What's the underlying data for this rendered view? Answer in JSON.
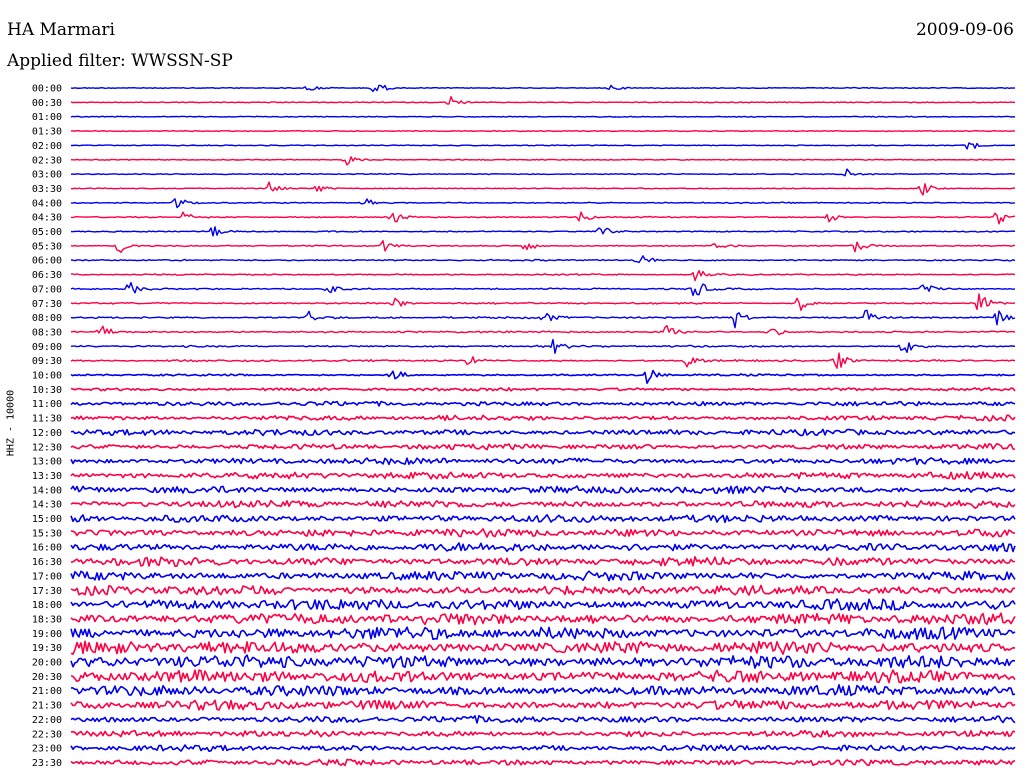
{
  "header": {
    "station": "HA Marmari",
    "date": "2009-09-06",
    "filter": "Applied filter: WWSSN-SP"
  },
  "chart_data": {
    "type": "line",
    "title": "HA Marmari",
    "subtitle": "Applied filter: WWSSN-SP",
    "ylabel": "HHZ - 10000",
    "xlabel": "",
    "colors": [
      "#0000ee",
      "#ff0044"
    ],
    "row_labels": [
      "00:00",
      "00:30",
      "01:00",
      "01:30",
      "02:00",
      "02:30",
      "03:00",
      "03:30",
      "04:00",
      "04:30",
      "05:00",
      "05:30",
      "06:00",
      "06:30",
      "07:00",
      "07:30",
      "08:00",
      "08:30",
      "09:00",
      "09:30",
      "10:00",
      "10:30",
      "11:00",
      "11:30",
      "12:00",
      "12:30",
      "13:00",
      "13:30",
      "14:00",
      "14:30",
      "15:00",
      "15:30",
      "16:00",
      "16:30",
      "17:00",
      "17:30",
      "18:00",
      "18:30",
      "19:00",
      "19:30",
      "20:00",
      "20:30",
      "21:00",
      "21:30",
      "22:00",
      "22:30",
      "23:00",
      "23:30"
    ],
    "noise_level": [
      0.15,
      0.12,
      0.15,
      0.13,
      0.15,
      0.14,
      0.15,
      0.2,
      0.3,
      0.35,
      0.35,
      0.35,
      0.45,
      0.45,
      0.55,
      0.55,
      0.65,
      0.6,
      0.6,
      0.6,
      0.7,
      1.2,
      1.8,
      2.0,
      2.4,
      2.2,
      2.6,
      2.7,
      3.0,
      3.0,
      3.2,
      3.3,
      3.5,
      3.6,
      3.8,
      4.0,
      4.6,
      4.8,
      5.2,
      5.4,
      5.4,
      5.2,
      4.4,
      4.0,
      2.8,
      2.6,
      2.3,
      2.4
    ],
    "events": [
      {
        "row": 0,
        "frac": 0.32,
        "amp": 10
      },
      {
        "row": 0,
        "frac": 0.25,
        "amp": 4
      },
      {
        "row": 0,
        "frac": 0.57,
        "amp": 4
      },
      {
        "row": 1,
        "frac": 0.4,
        "amp": 9
      },
      {
        "row": 4,
        "frac": 0.95,
        "amp": 8
      },
      {
        "row": 5,
        "frac": 0.29,
        "amp": 9
      },
      {
        "row": 6,
        "frac": 0.82,
        "amp": 7
      },
      {
        "row": 7,
        "frac": 0.21,
        "amp": 7
      },
      {
        "row": 7,
        "frac": 0.26,
        "amp": 7
      },
      {
        "row": 7,
        "frac": 0.9,
        "amp": 8
      },
      {
        "row": 8,
        "frac": 0.11,
        "amp": 10
      },
      {
        "row": 8,
        "frac": 0.31,
        "amp": 6
      },
      {
        "row": 9,
        "frac": 0.12,
        "amp": 9
      },
      {
        "row": 9,
        "frac": 0.34,
        "amp": 9
      },
      {
        "row": 9,
        "frac": 0.54,
        "amp": 10
      },
      {
        "row": 9,
        "frac": 0.8,
        "amp": 8
      },
      {
        "row": 9,
        "frac": 0.98,
        "amp": 8
      },
      {
        "row": 10,
        "frac": 0.15,
        "amp": 8
      },
      {
        "row": 10,
        "frac": 0.56,
        "amp": 9
      },
      {
        "row": 11,
        "frac": 0.05,
        "amp": 9
      },
      {
        "row": 11,
        "frac": 0.33,
        "amp": 7
      },
      {
        "row": 11,
        "frac": 0.48,
        "amp": 7
      },
      {
        "row": 11,
        "frac": 0.68,
        "amp": 7
      },
      {
        "row": 11,
        "frac": 0.83,
        "amp": 7
      },
      {
        "row": 12,
        "frac": 0.6,
        "amp": 9
      },
      {
        "row": 13,
        "frac": 0.66,
        "amp": 7
      },
      {
        "row": 14,
        "frac": 0.06,
        "amp": 9
      },
      {
        "row": 14,
        "frac": 0.27,
        "amp": 9
      },
      {
        "row": 14,
        "frac": 0.66,
        "amp": 13
      },
      {
        "row": 14,
        "frac": 0.9,
        "amp": 9
      },
      {
        "row": 15,
        "frac": 0.34,
        "amp": 8
      },
      {
        "row": 15,
        "frac": 0.77,
        "amp": 9
      },
      {
        "row": 15,
        "frac": 0.96,
        "amp": 14
      },
      {
        "row": 16,
        "frac": 0.25,
        "amp": 8
      },
      {
        "row": 16,
        "frac": 0.5,
        "amp": 8
      },
      {
        "row": 16,
        "frac": 0.7,
        "amp": 14
      },
      {
        "row": 16,
        "frac": 0.84,
        "amp": 9
      },
      {
        "row": 16,
        "frac": 0.98,
        "amp": 10
      },
      {
        "row": 17,
        "frac": 0.03,
        "amp": 10
      },
      {
        "row": 17,
        "frac": 0.63,
        "amp": 9
      },
      {
        "row": 17,
        "frac": 0.74,
        "amp": 8
      },
      {
        "row": 18,
        "frac": 0.51,
        "amp": 8
      },
      {
        "row": 18,
        "frac": 0.88,
        "amp": 11
      },
      {
        "row": 19,
        "frac": 0.42,
        "amp": 9
      },
      {
        "row": 19,
        "frac": 0.65,
        "amp": 9
      },
      {
        "row": 19,
        "frac": 0.81,
        "amp": 12
      },
      {
        "row": 20,
        "frac": 0.61,
        "amp": 9
      },
      {
        "row": 20,
        "frac": 0.34,
        "amp": 9
      }
    ]
  }
}
